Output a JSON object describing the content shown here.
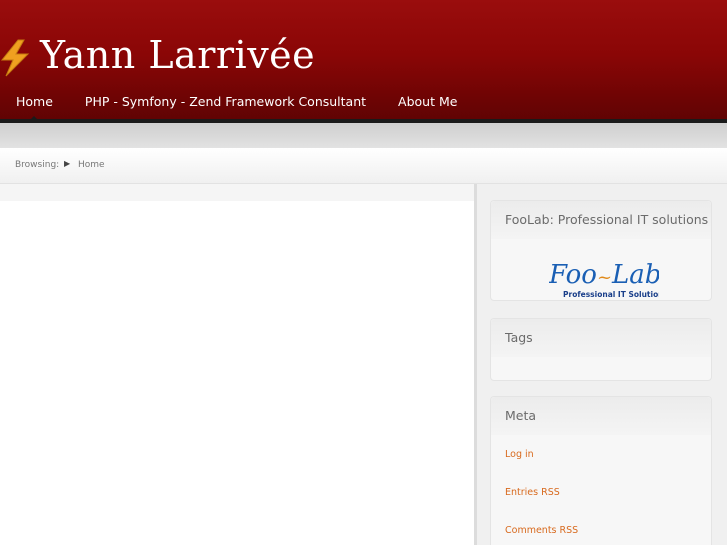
{
  "header": {
    "title": "Yann Larrivée",
    "logo_icon": "lightning-bolt-icon"
  },
  "nav": {
    "items": [
      {
        "label": "Home",
        "active": true
      },
      {
        "label": "PHP - Symfony - Zend Framework Consultant",
        "active": false
      },
      {
        "label": "About Me",
        "active": false
      }
    ]
  },
  "breadcrumb": {
    "label": "Browsing:",
    "separator_icon": "triangle-right-icon",
    "current": "Home"
  },
  "sidebar": {
    "widgets": [
      {
        "title": "FooLab: Professional IT solutions",
        "logo": {
          "word_part1": "Foo",
          "word_part2": "Lab",
          "tagline": "Professional IT Solutions"
        }
      },
      {
        "title": "Tags"
      },
      {
        "title": "Meta",
        "links": [
          "Log in",
          "Entries RSS",
          "Comments RSS"
        ]
      }
    ]
  },
  "colors": {
    "header_red": "#8a0606",
    "link_orange": "#d86a1e",
    "bolt_orange": "#f0a020",
    "foolab_blue": "#1a5fb4"
  }
}
